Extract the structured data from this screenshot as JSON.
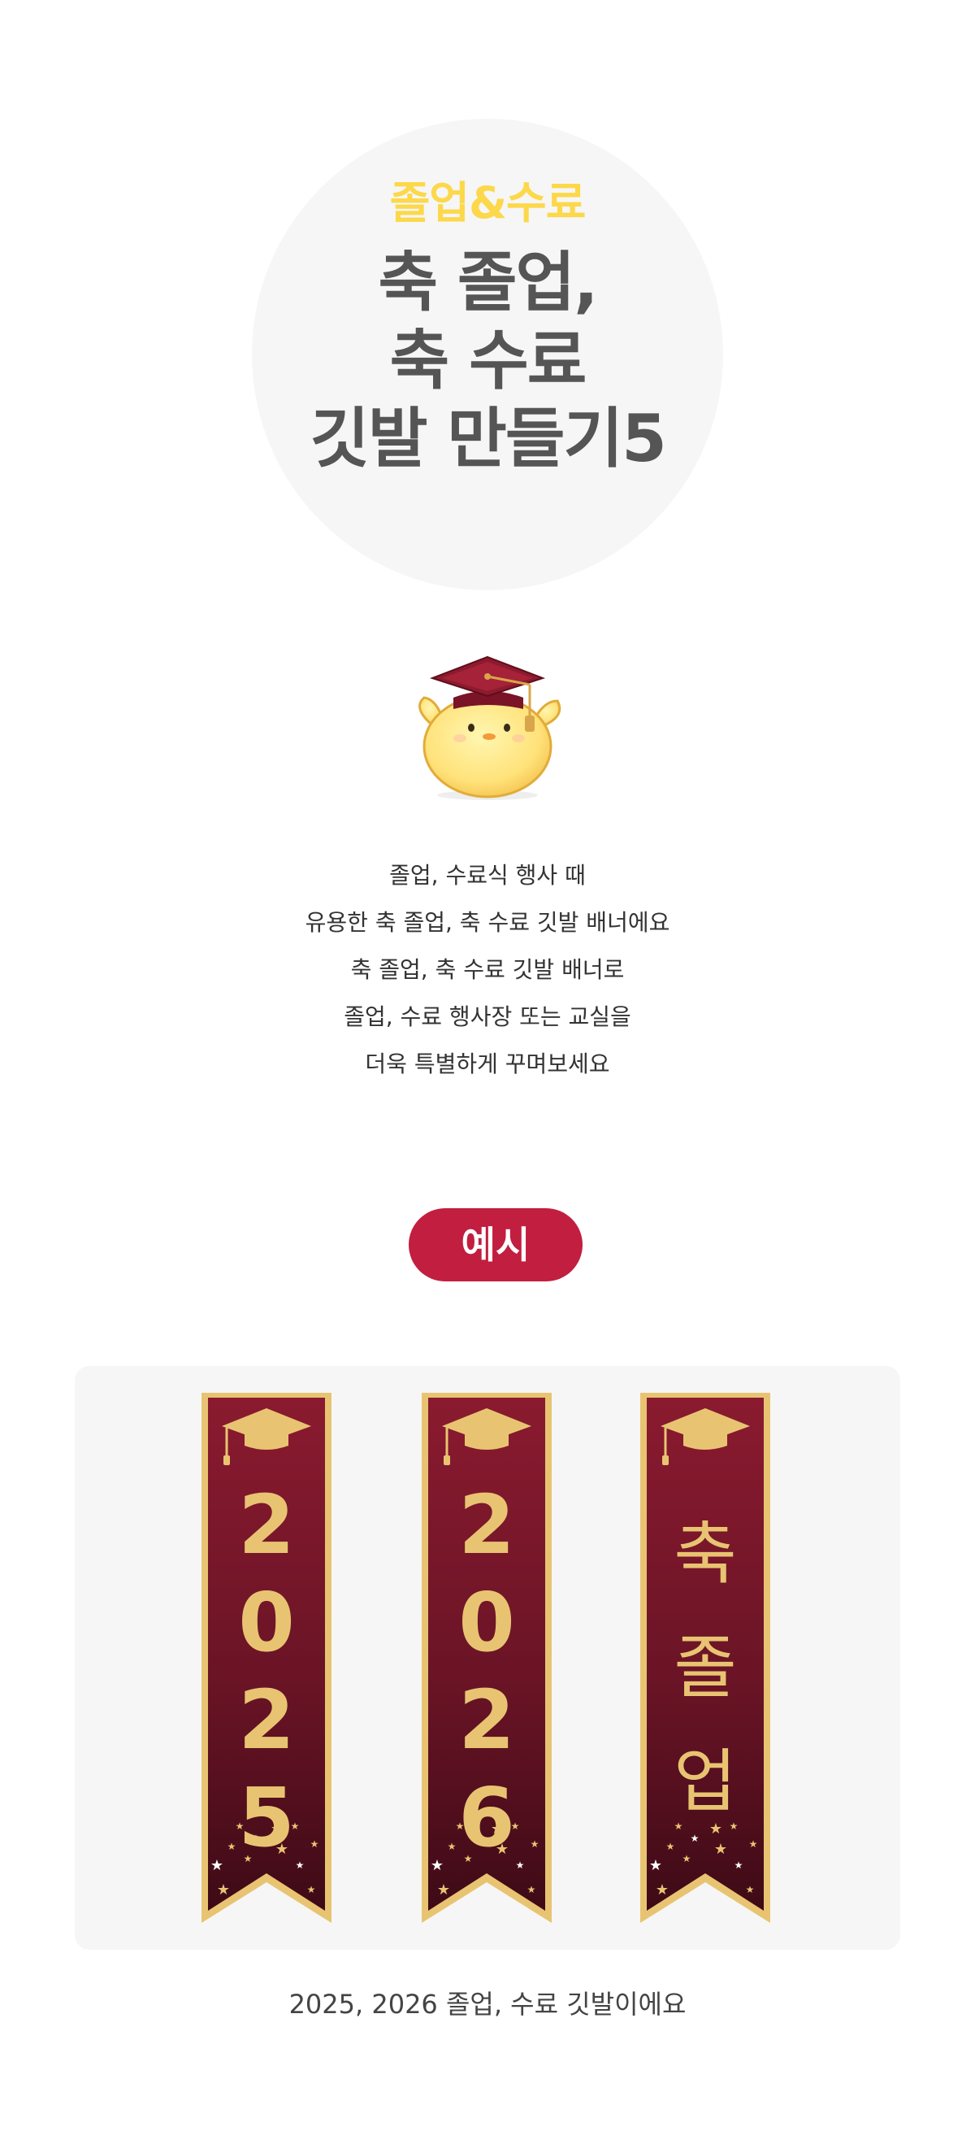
{
  "hero": {
    "subtitle": "졸업&수료",
    "title_lines": [
      "축 졸업,",
      "축 수료",
      "깃발 만들기5"
    ]
  },
  "mascot": {
    "icon": "graduation-chick-icon"
  },
  "description_lines": [
    "졸업, 수료식 행사 때",
    "유용한 축 졸업, 축 수료 깃발 배너에요",
    "축 졸업, 축 수료 깃발 배너로",
    "졸업, 수료 행사장 또는 교실을",
    "더욱 특별하게 꾸며보세요"
  ],
  "example_label": "예시",
  "banners": [
    {
      "chars": [
        "2",
        "0",
        "2",
        "5"
      ]
    },
    {
      "chars": [
        "2",
        "0",
        "2",
        "6"
      ]
    },
    {
      "chars": [
        "축",
        "졸",
        "업"
      ]
    }
  ],
  "caption": "2025, 2026 졸업, 수료 깃발이에요",
  "colors": {
    "accent_red": "#c21e3f",
    "banner_top": "#8a1a2f",
    "banner_bottom": "#3e0a16",
    "gold": "#e8c472",
    "subtitle_yellow": "#fcd84a"
  }
}
